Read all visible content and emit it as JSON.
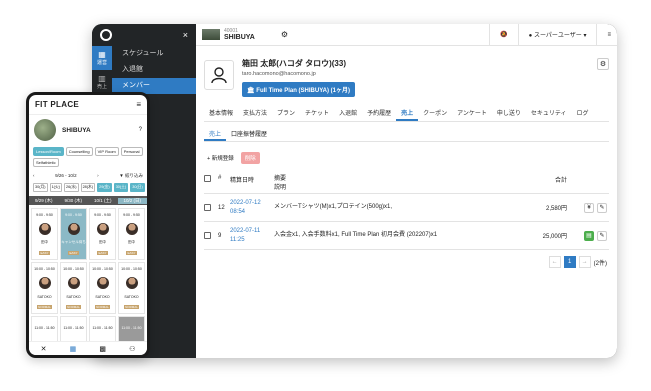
{
  "desktop": {
    "sidebar": {
      "close_icon": "×",
      "tabs": [
        {
          "icon": "calendar-icon",
          "glyph": "▦",
          "label": "運営"
        },
        {
          "icon": "chart-icon",
          "glyph": "▥",
          "label": "売上"
        }
      ],
      "menu": [
        "スケジュール",
        "入退館",
        "メンバー"
      ],
      "active_menu": "メンバー"
    },
    "topbar": {
      "store_id": "40001",
      "store_name": "SHIBUYA",
      "gear_glyph": "⚙",
      "bell_glyph": "🔕",
      "user_label": "スーパーユーザー",
      "chevron": "▾",
      "menu_glyph": "≡"
    },
    "member": {
      "name": "箱田 太郎(ハコダ タロウ)(33)",
      "email": "taro.hacomono@hacomono.jp",
      "plan": "Full Time Plan (SHIBUYA) (1ヶ月)",
      "gear_glyph": "⚙"
    },
    "tabs": [
      "基本情報",
      "支払方法",
      "プラン",
      "チケット",
      "入退館",
      "予約履歴",
      "売上",
      "クーポン",
      "アンケート",
      "申し送り",
      "セキュリティ",
      "ログ"
    ],
    "active_tab": "売上",
    "subtabs": [
      "売上",
      "口座振替履歴"
    ],
    "actions": {
      "new": "+ 新規登録",
      "delete": "削除"
    },
    "table": {
      "headers": {
        "no": "#",
        "date": "精算日時",
        "summary": "摘要",
        "summary2": "説明",
        "total": "合計"
      },
      "rows": [
        {
          "no": "12",
          "date": "2022-07-12",
          "time": "08:54",
          "summary": "メンバーTシャツ(M)x1,プロテイン(500g)x1,",
          "total": "2,580円",
          "ops": [
            "¥",
            "✎"
          ]
        },
        {
          "no": "9",
          "date": "2022-07-11",
          "time": "11:25",
          "summary": "入会金x1, 入会手数料x1, Full Time Plan 初月会費 (202207)x1",
          "total": "25,000円",
          "ops": [
            "▤",
            "✎"
          ]
        }
      ]
    },
    "pager": {
      "prev": "←",
      "current": "1",
      "next": "→",
      "count": "(2件)"
    }
  },
  "phone": {
    "brand": "FIT PLACE",
    "menu_glyph": "≡",
    "store_name": "SHIBUYA",
    "help_glyph": "?",
    "chips": [
      {
        "label": "Lesson/Room",
        "on": true
      },
      {
        "label": "Counselling",
        "on": false
      },
      {
        "label": "VIP Room",
        "on": false
      },
      {
        "label": "Personal",
        "on": false
      },
      {
        "label": "Selfathletic",
        "on": false
      }
    ],
    "filter_left": "‹",
    "filter_mid": "9/26 - 10/2",
    "filter_right": "›",
    "filter_btn": "▼ 絞り込み",
    "times": [
      {
        "label": "30(月)",
        "on": false
      },
      {
        "label": "1(火)",
        "on": false
      },
      {
        "label": "26(水)",
        "on": false
      },
      {
        "label": "28(木)",
        "on": false
      },
      {
        "label": "29(金)",
        "on": true
      },
      {
        "label": "30(土)",
        "on": true
      },
      {
        "label": "30(日)",
        "on": true
      }
    ],
    "days": [
      {
        "label": "9/29 (木)",
        "hl": false
      },
      {
        "label": "9/30 (木)",
        "hl": false
      },
      {
        "label": "10/1 (土)",
        "hl": false
      },
      {
        "label": "10/2 (日)",
        "hl": true
      }
    ],
    "slots": [
      {
        "time": "9:00 - 9:50",
        "name": "田中",
        "tag": "EASY",
        "style": ""
      },
      {
        "time": "9:00 - 9:50",
        "name": "キャンセル待ち",
        "tag": "EASY",
        "style": "blue"
      },
      {
        "time": "9:00 - 9:50",
        "name": "田中",
        "tag": "EASY",
        "style": ""
      },
      {
        "time": "9:00 - 9:50",
        "name": "田中",
        "tag": "EASY",
        "style": ""
      },
      {
        "time": "10:00 - 10:50",
        "name": "SATOKO",
        "tag": "NORMAL",
        "style": ""
      },
      {
        "time": "10:00 - 10:50",
        "name": "SATOKO",
        "tag": "NORMAL",
        "style": ""
      },
      {
        "time": "10:00 - 10:50",
        "name": "SATOKO",
        "tag": "NORMAL",
        "style": ""
      },
      {
        "time": "10:00 - 10:50",
        "name": "SATOKO",
        "tag": "NORMAL",
        "style": ""
      },
      {
        "time": "11:00 - 11:50",
        "name": "",
        "tag": "",
        "style": ""
      },
      {
        "time": "11:00 - 11:50",
        "name": "",
        "tag": "",
        "style": ""
      },
      {
        "time": "11:00 - 11:50",
        "name": "",
        "tag": "",
        "style": ""
      },
      {
        "time": "11:00 - 11:50",
        "name": "",
        "tag": "",
        "style": "gray"
      }
    ],
    "nav": [
      "✕",
      "▦",
      "▩",
      "⚇"
    ]
  }
}
